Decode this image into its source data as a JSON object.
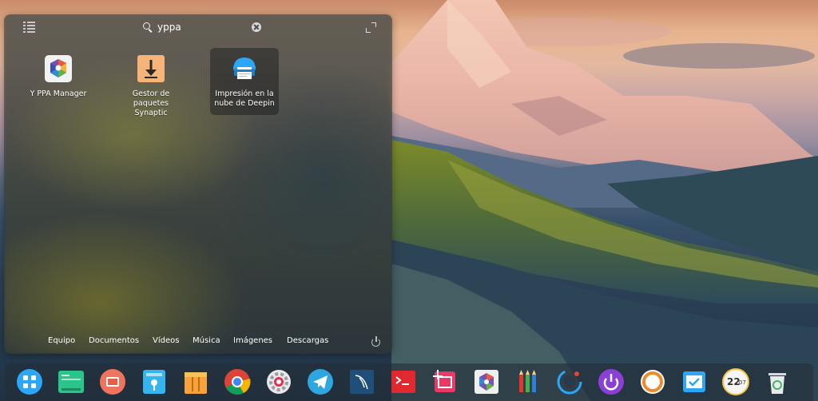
{
  "launcher": {
    "search": {
      "query": "yppa"
    },
    "apps": [
      {
        "name": "Y PPA Manager"
      },
      {
        "name_line1": "Gestor de",
        "name_line2": "paquetes Synaptic"
      },
      {
        "name_line1": "Impresión en la",
        "name_line2": "nube de Deepin"
      }
    ],
    "categories": [
      "Equipo",
      "Documentos",
      "Vídeos",
      "Música",
      "Imágenes",
      "Descargas"
    ]
  },
  "dock": {
    "calendar_day": "22",
    "calendar_month": "07",
    "items": [
      "launcher-icon",
      "deepin-manual-icon",
      "screen-recorder-icon",
      "app-store-icon",
      "archive-manager-icon",
      "chrome-icon",
      "settings-icon",
      "telegram-icon",
      "mysql-workbench-icon",
      "terminal-icon",
      "screenshot-icon",
      "y-ppa-manager-icon",
      "pencils-icon",
      "system-monitor-icon",
      "power-icon",
      "ubuntu-icon",
      "deepin-cloud-icon",
      "clock-icon",
      "trash-icon"
    ]
  },
  "colors": {
    "accent": "#2ca7f8",
    "selection": "#1d2226"
  }
}
